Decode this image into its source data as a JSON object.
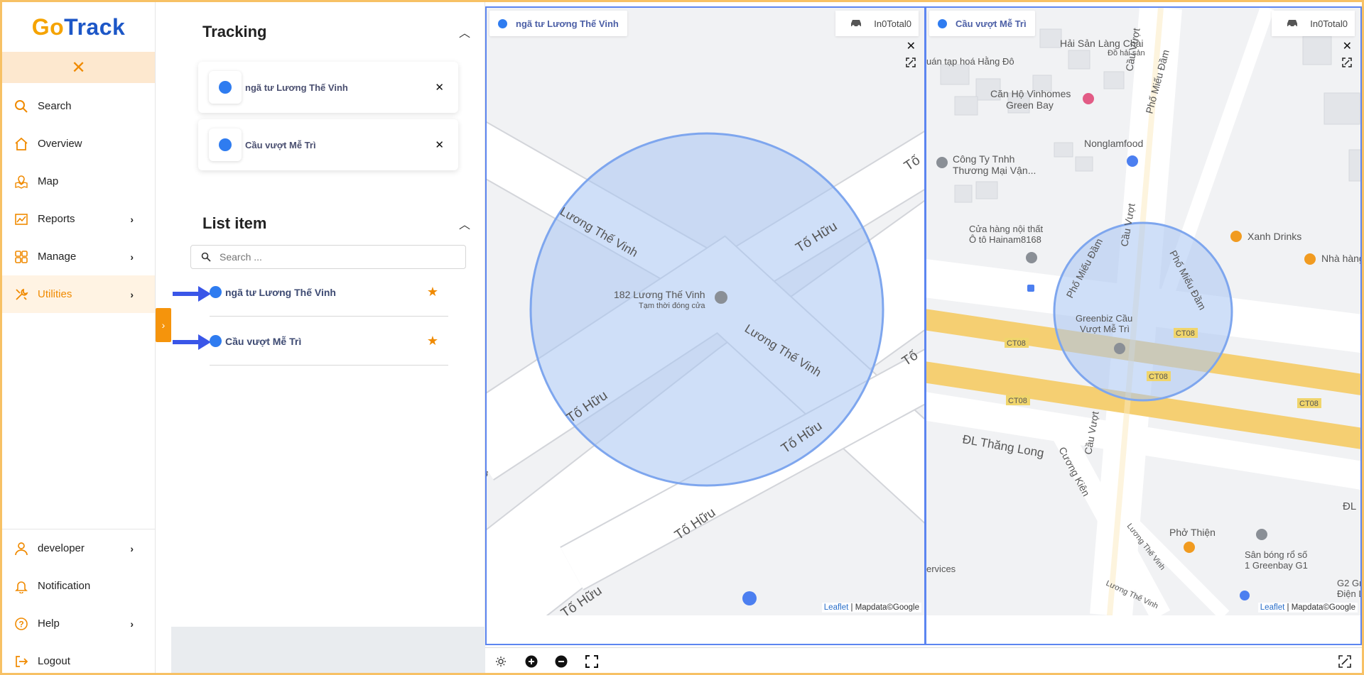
{
  "app": {
    "logo_go": "Go",
    "logo_track": "Track",
    "close_glyph": "✕"
  },
  "sidebar": {
    "items": [
      {
        "label": "Search",
        "icon": "search-icon"
      },
      {
        "label": "Overview",
        "icon": "home-icon"
      },
      {
        "label": "Map",
        "icon": "map-icon"
      },
      {
        "label": "Reports",
        "icon": "chart-icon",
        "chevron": true
      },
      {
        "label": "Manage",
        "icon": "grid-icon",
        "chevron": true
      },
      {
        "label": "Utilities",
        "icon": "tools-icon",
        "chevron": true,
        "active": true
      }
    ],
    "bottom_items": [
      {
        "label": "developer",
        "icon": "user-icon",
        "chevron": true
      },
      {
        "label": "Notification",
        "icon": "bell-icon"
      },
      {
        "label": "Help",
        "icon": "help-icon",
        "chevron": true
      },
      {
        "label": "Logout",
        "icon": "logout-icon"
      }
    ]
  },
  "panel": {
    "tracking_title": "Tracking",
    "tracking_items": [
      {
        "name": "ngã tư Lương Thế Vinh"
      },
      {
        "name": "Cầu vượt Mễ Trì"
      }
    ],
    "list_title": "List item",
    "search_placeholder": "Search ...",
    "list_items": [
      {
        "name": "ngã tư Lương Thế Vinh"
      },
      {
        "name": "Cầu vượt Mễ Trì"
      }
    ]
  },
  "maps": [
    {
      "title": "ngã tư Lương Thế Vinh",
      "count": "In0Total0",
      "attribution_link": "Leaflet",
      "attribution_rest": " | Mapdata©Google",
      "labels": {
        "road1": "Lương Thế Vinh",
        "road1b": "Lương Thế Vinh",
        "road2a": "Tố Hữu",
        "road2b": "Tố Hữu",
        "road2c": "Tố Hữu",
        "road2d": "Tố Hữu",
        "road2e": "Tố Hữu",
        "road2f": "Tố",
        "road2g": "Tố",
        "road2h": "ữu",
        "poi_name": "182 Lương Thế Vinh",
        "poi_status": "Tạm thời đóng cửa"
      }
    },
    {
      "title": "Cầu vượt Mễ Trì",
      "count": "In0Total0",
      "attribution_link": "Leaflet",
      "attribution_rest": " | Mapdata©Google",
      "labels": {
        "hai_san": "Hải Sản Làng Chài",
        "do_hai_san": "Đồ hải sản",
        "tap_hoa": "uán tạp hoá Hằng Đô",
        "can_ho1": "Căn Hộ Vinhomes",
        "can_ho2": "Green Bay",
        "nonglam": "Nonglamfood",
        "cong_ty1": "Công Ty Tnhh",
        "cong_ty2": "Thương Mại Vận...",
        "cua_hang1": "Cửa hàng nội thất",
        "cua_hang2": "Ô tô Hainam8168",
        "xanh": "Xanh Drinks",
        "nha_hang": "Nhà hàng",
        "greenbiz1": "Greenbiz Cầu",
        "greenbiz2": "Vượt Mễ Trì",
        "ct08": "CT08",
        "dl_thang_long": "ĐL Thăng Long",
        "cuong_kien": "Cương Kiên",
        "cau_vuot": "Cầu Vượt",
        "pho_mieu_dam": "Phố Miếu Đầm",
        "pho_thien": "Phở Thiện",
        "san_bong1": "Sân bóng rổ số",
        "san_bong2": "1 Greenbay G1",
        "luong_the_vinh": "Lương Thế Vinh",
        "services": "ervices",
        "g2": "G2 Gre",
        "dien": "Điện L",
        "dl": "ĐL"
      }
    }
  ],
  "colors": {
    "accent": "#f08a00",
    "brand_blue": "#1d57c7",
    "dot_blue": "#2f7cf0",
    "geofence": "#aac6f5"
  }
}
